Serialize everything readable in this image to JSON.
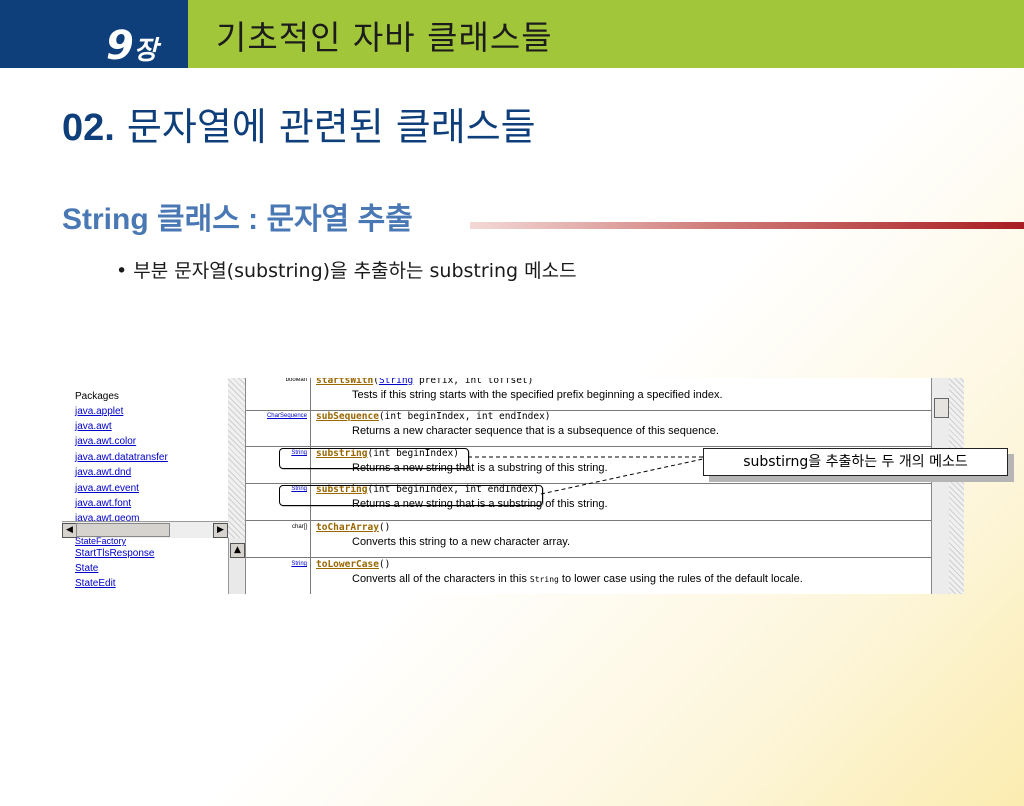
{
  "header": {
    "chapter_number": "9",
    "chapter_suffix": "장",
    "title": "기초적인 자바 클래스들"
  },
  "section": {
    "number": "02.",
    "title": "문자열에 관련된 클래스들"
  },
  "subsection": {
    "title": "String 클래스 : 문자열 추출"
  },
  "bullet": "• 부분 문자열(substring)을 추출하는 substring 메소드",
  "javadoc": {
    "packages_label": "Packages",
    "packages": [
      "java.applet",
      "java.awt",
      "java.awt.color",
      "java.awt.datatransfer",
      "java.awt.dnd",
      "java.awt.event",
      "java.awt.font",
      "java.awt.geom"
    ],
    "classes": [
      "StartTlsResponse",
      "State",
      "StateEdit",
      "StateFactory"
    ],
    "methods": [
      {
        "type": "boolean",
        "type_is_link": false,
        "name": "startsWith",
        "sig_pre": "(",
        "sig_link": "String",
        "sig_post": " prefix, int toffset)",
        "desc": "Tests if this string starts with the specified prefix beginning a specified index."
      },
      {
        "type": "CharSequence",
        "type_is_link": true,
        "name": "subSequence",
        "sig_pre": "(int beginIndex, int endIndex)",
        "sig_link": "",
        "sig_post": "",
        "desc": "Returns a new character sequence that is a subsequence of this sequence."
      },
      {
        "type": "String",
        "type_is_link": true,
        "name": "substring",
        "sig_pre": "(int beginIndex)",
        "sig_link": "",
        "sig_post": "",
        "desc": "Returns a new string that is a substring of this string."
      },
      {
        "type": "String",
        "type_is_link": true,
        "name": "substring",
        "sig_pre": "(int beginIndex, int endIndex)",
        "sig_link": "",
        "sig_post": "",
        "desc": "Returns a new string that is a substring of this string."
      },
      {
        "type": "char[]",
        "type_is_link": false,
        "name": "toCharArray",
        "sig_pre": "()",
        "sig_link": "",
        "sig_post": "",
        "desc": "Converts this string to a new character array."
      },
      {
        "type": "String",
        "type_is_link": true,
        "name": "toLowerCase",
        "sig_pre": "()",
        "sig_link": "",
        "sig_post": "",
        "desc_pre": "Converts all of the characters in this ",
        "desc_code": "String",
        "desc_post": " to lower case using the rules of the default locale."
      }
    ]
  },
  "callout": "substirng을 추출하는 두 개의 메소드"
}
